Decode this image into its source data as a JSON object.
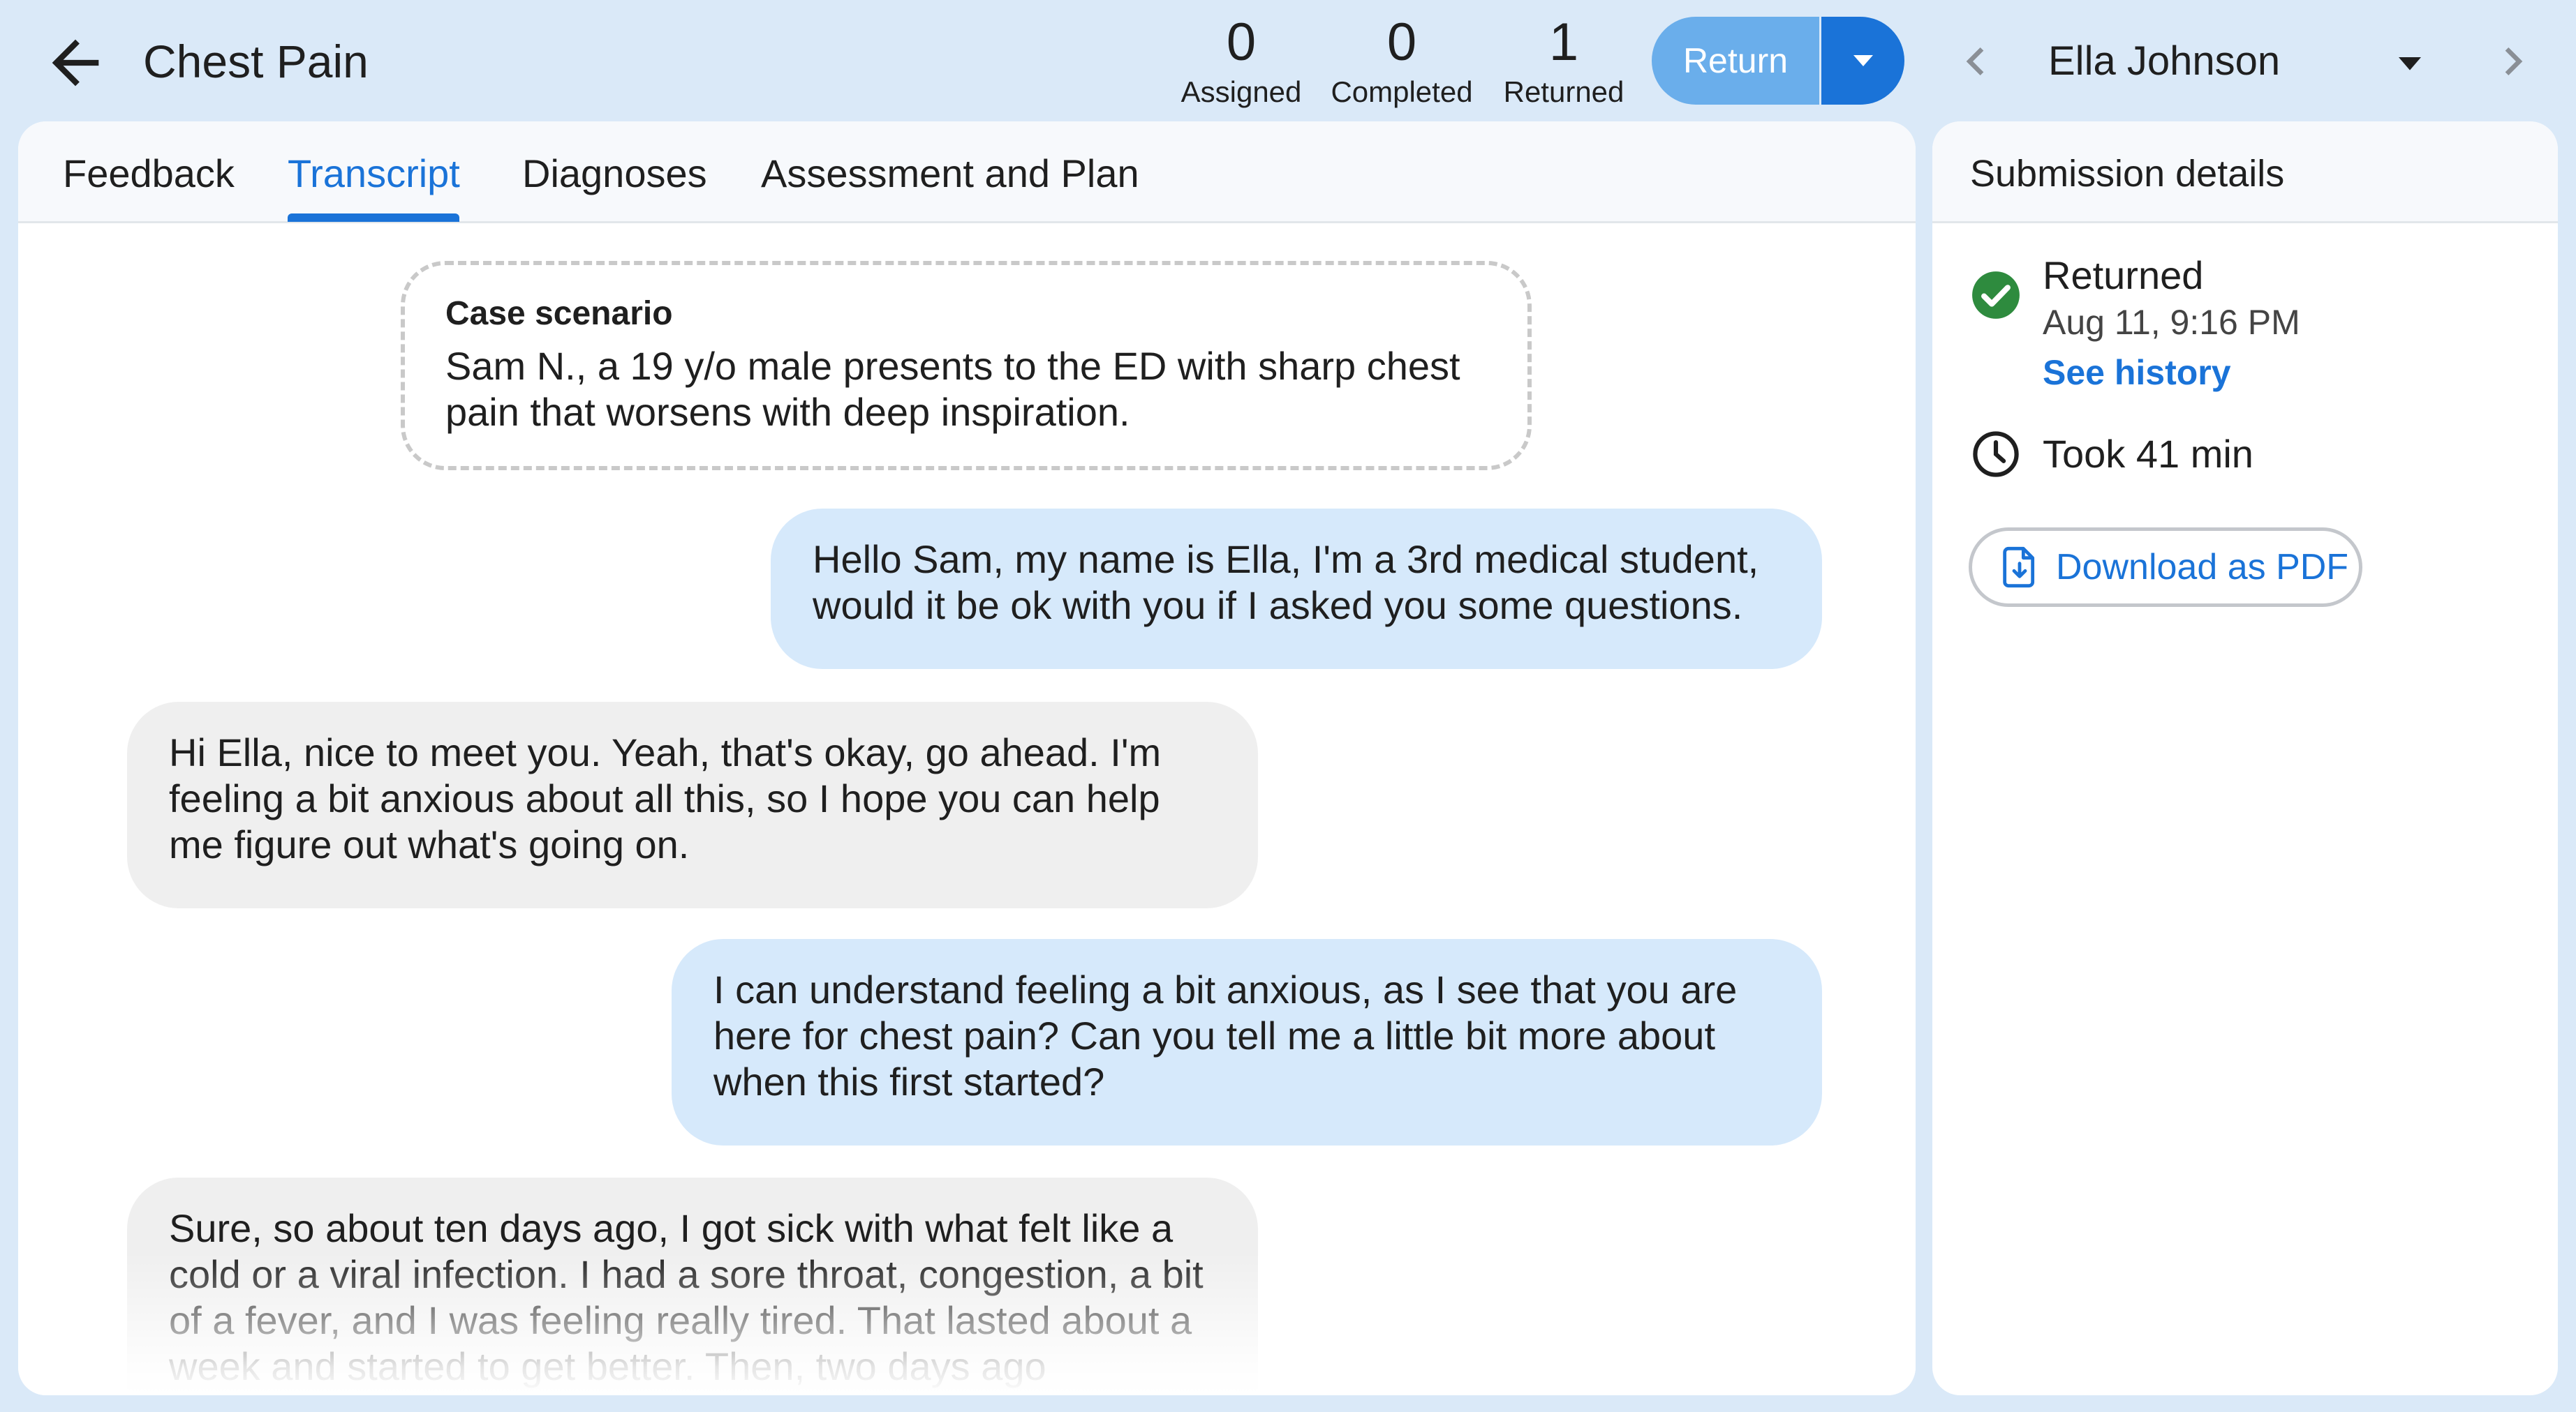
{
  "header": {
    "back_icon": "arrow-left-icon",
    "case_title": "Chest Pain",
    "counters": {
      "assigned": {
        "value": "0",
        "label": "Assigned"
      },
      "completed": {
        "value": "0",
        "label": "Completed"
      },
      "returned": {
        "value": "1",
        "label": "Returned"
      }
    },
    "return_button": "Return",
    "return_menu_icon": "caret-down-icon",
    "student": {
      "name": "Ella Johnson",
      "prev_icon": "chevron-left-icon",
      "dropdown_icon": "caret-down-icon",
      "next_icon": "chevron-right-icon"
    }
  },
  "tabs": [
    {
      "label": "Feedback"
    },
    {
      "label": "Transcript",
      "active": true
    },
    {
      "label": "Diagnoses"
    },
    {
      "label": "Assessment and Plan"
    }
  ],
  "transcript": {
    "case_label": "Case scenario",
    "case_text": "Sam N., a 19 y/o male presents to the ED with sharp chest pain that worsens with deep inspiration.",
    "messages": [
      {
        "role": "student",
        "text": "Hello Sam, my name is Ella, I'm a 3rd medical student, would it be ok with you if I asked you some questions."
      },
      {
        "role": "patient",
        "text": "Hi Ella, nice to meet you. Yeah, that's okay, go ahead. I'm feeling a bit anxious about all this, so I hope you can help me figure out what's going on."
      },
      {
        "role": "student",
        "text": "I can understand feeling a bit anxious, as I see that you are here for chest pain? Can you tell me a little bit more about when this first started?"
      },
      {
        "role": "patient",
        "text": "Sure, so about ten days ago, I got sick with what felt like a cold or a viral infection. I had a sore throat, congestion, a bit of a fever, and I was feeling really tired. That lasted about a week and started to get better. Then, two days ago"
      }
    ]
  },
  "submission": {
    "title": "Submission details",
    "status": "Returned",
    "status_icon": "check-circle-icon",
    "date": "Aug 11, 9:16 PM",
    "history_link": "See history",
    "duration_icon": "clock-icon",
    "duration": "Took 41 min",
    "download_label": "Download as PDF",
    "download_icon": "file-download-icon"
  },
  "colors": {
    "background": "#dae9f8",
    "accent": "#1a73d8",
    "return_button": "#6aaeeb",
    "student_bubble": "#d6e9fb",
    "patient_bubble": "#efefef",
    "success": "#2e8b3e"
  }
}
